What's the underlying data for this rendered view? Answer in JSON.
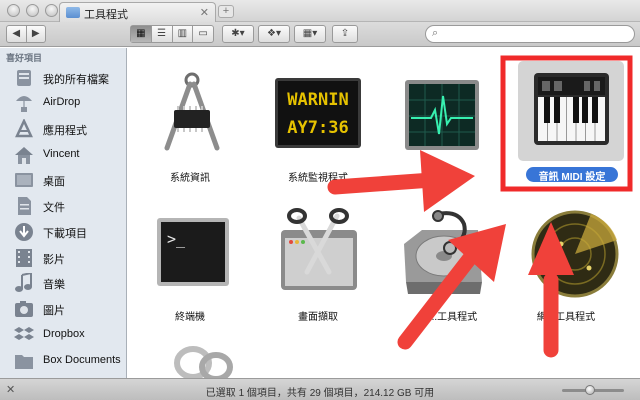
{
  "window": {
    "tab_title": "工具程式",
    "tab_close": "✕",
    "new_tab": "+"
  },
  "toolbar": {
    "back": "◀",
    "forward": "▶",
    "view_modes": [
      "▦",
      "☰",
      "▥",
      "▭"
    ],
    "action": "✱▾",
    "dropbox": "❖▾",
    "arrange": "▦▾",
    "share": "⇪"
  },
  "sidebar": {
    "heading": "喜好項目",
    "items": [
      {
        "label": "我的所有檔案",
        "icon": "all-files-icon"
      },
      {
        "label": "AirDrop",
        "icon": "airdrop-icon"
      },
      {
        "label": "應用程式",
        "icon": "applications-icon"
      },
      {
        "label": "Vincent",
        "icon": "home-icon"
      },
      {
        "label": "桌面",
        "icon": "desktop-icon"
      },
      {
        "label": "文件",
        "icon": "documents-icon"
      },
      {
        "label": "下載項目",
        "icon": "downloads-icon"
      },
      {
        "label": "影片",
        "icon": "movies-icon"
      },
      {
        "label": "音樂",
        "icon": "music-icon"
      },
      {
        "label": "圖片",
        "icon": "pictures-icon"
      },
      {
        "label": "Dropbox",
        "icon": "dropbox-icon"
      },
      {
        "label": "Box Documents",
        "icon": "folder-icon"
      }
    ]
  },
  "content": {
    "items": [
      {
        "name": "系統資訊",
        "icon": "system-information-icon"
      },
      {
        "name": "系統監視程式",
        "icon": "activity-monitor-icon",
        "display": [
          "WARNIN",
          "AY7:36"
        ]
      },
      {
        "name": "",
        "icon": "console-icon"
      },
      {
        "name": "音訊 MIDI 設定",
        "icon": "audio-midi-icon",
        "selected": true
      },
      {
        "name": "終端機",
        "icon": "terminal-icon",
        "prompt": ">_"
      },
      {
        "name": "畫面擷取",
        "icon": "grab-icon"
      },
      {
        "name": "磁...工具程式",
        "icon": "disk-utility-icon"
      },
      {
        "name": "網...工具程式",
        "icon": "network-utility-icon"
      }
    ]
  },
  "status": {
    "text": "已選取 1 個項目，共有 29 個項目，214.12 GB 可用",
    "zoom_level": 0.45
  },
  "colors": {
    "annotation_red": "#f0413a",
    "selection_blue": "#3875d7",
    "box_red": "#f02a2a"
  }
}
